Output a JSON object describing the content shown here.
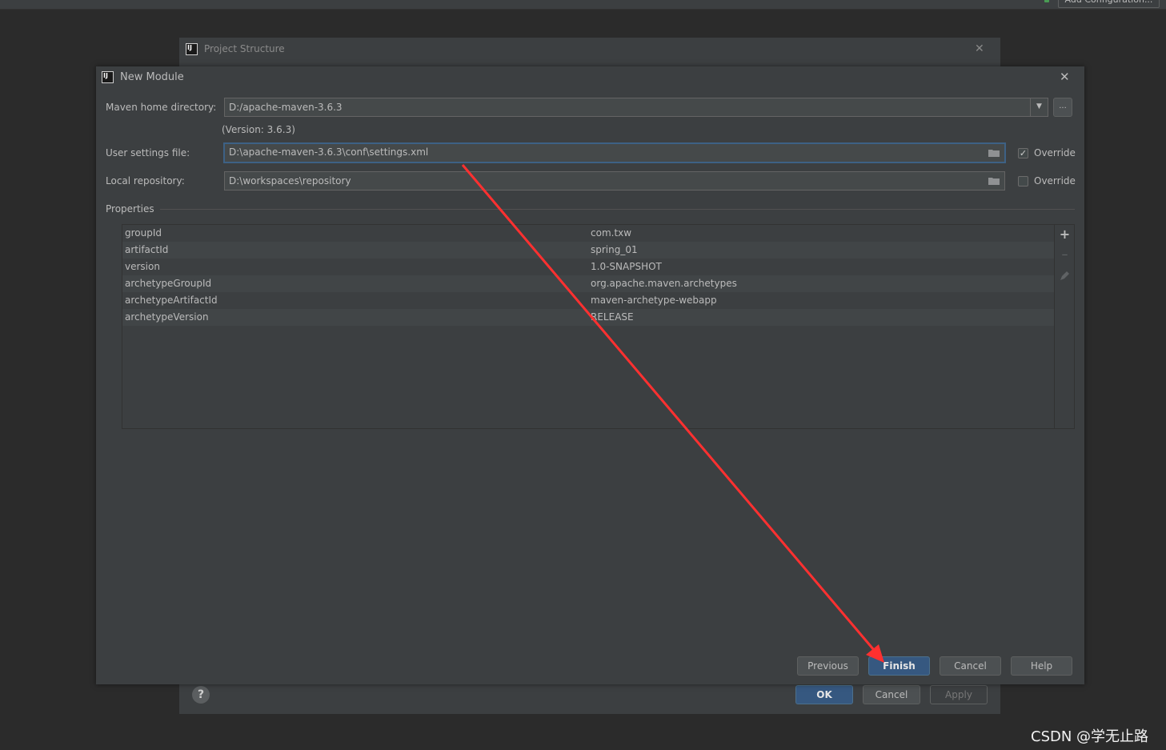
{
  "top_button": "Add Configuration...",
  "project_structure": {
    "title": "Project Structure",
    "buttons": {
      "ok": "OK",
      "cancel": "Cancel",
      "apply": "Apply"
    },
    "help": "?"
  },
  "new_module": {
    "title": "New Module",
    "maven_home_label": "Maven home directory:",
    "maven_home_value": "D:/apache-maven-3.6.3",
    "version_note": "(Version: 3.6.3)",
    "more_button": "...",
    "user_settings_label": "User settings file:",
    "user_settings_value": "D:\\apache-maven-3.6.3\\conf\\settings.xml",
    "user_settings_override": {
      "label": "Override",
      "checked": true
    },
    "local_repo_label": "Local repository:",
    "local_repo_value": "D:\\workspaces\\repository",
    "local_repo_override": {
      "label": "Override",
      "checked": false
    },
    "properties_label": "Properties",
    "properties": [
      {
        "key": "groupId",
        "value": "com.txw"
      },
      {
        "key": "artifactId",
        "value": "spring_01"
      },
      {
        "key": "version",
        "value": "1.0-SNAPSHOT"
      },
      {
        "key": "archetypeGroupId",
        "value": "org.apache.maven.archetypes"
      },
      {
        "key": "archetypeArtifactId",
        "value": "maven-archetype-webapp"
      },
      {
        "key": "archetypeVersion",
        "value": "RELEASE"
      }
    ],
    "buttons": {
      "previous": "Previous",
      "finish": "Finish",
      "cancel": "Cancel",
      "help": "Help"
    }
  },
  "colors": {
    "accent": "#365880",
    "annotation_arrow": "#ff3030",
    "background": "#2b2b2b",
    "dialog": "#3c3f41"
  },
  "watermark": "CSDN @学无止路"
}
